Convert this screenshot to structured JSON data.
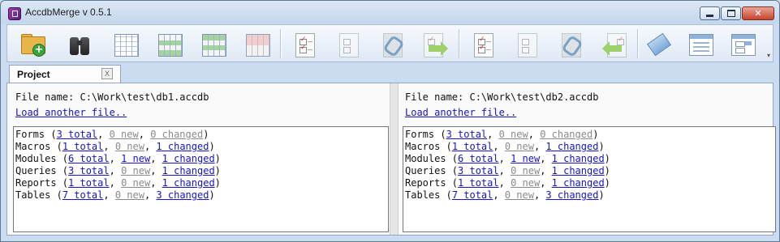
{
  "window": {
    "title": "AccdbMerge v 0.5.1"
  },
  "toolbar": {
    "buttons": [
      {
        "name": "open-folder-button",
        "icon": "folder-add-icon"
      },
      {
        "name": "compare-button",
        "icon": "binoculars-icon"
      },
      {
        "name": "table-view-button",
        "icon": "table-icon"
      },
      {
        "name": "table-green-button",
        "icon": "table-green-icon"
      },
      {
        "name": "table-green2-button",
        "icon": "table-green-alt-icon"
      },
      {
        "name": "table-red-button",
        "icon": "table-red-icon"
      },
      {
        "name": "checklist-button",
        "icon": "checklist-icon"
      },
      {
        "name": "checklist-empty-button",
        "icon": "checklist-empty-icon"
      },
      {
        "name": "link-button",
        "icon": "chain-link-icon"
      },
      {
        "name": "copy-right-button",
        "icon": "arrow-right-icon"
      },
      {
        "name": "checklist2-button",
        "icon": "checklist-icon"
      },
      {
        "name": "checklist2-empty-button",
        "icon": "checklist-empty-icon"
      },
      {
        "name": "link2-button",
        "icon": "chain-link-icon"
      },
      {
        "name": "copy-left-button",
        "icon": "arrow-left-icon"
      },
      {
        "name": "tag-button",
        "icon": "tag-icon"
      },
      {
        "name": "form-button",
        "icon": "form-icon"
      },
      {
        "name": "form2-button",
        "icon": "form-alt-icon"
      }
    ]
  },
  "tabs": [
    {
      "label": "Project",
      "close": "X"
    }
  ],
  "left": {
    "file_name": "File name: C:\\Work\\test\\db1.accdb",
    "load_link": "Load another file..",
    "items": [
      {
        "name": "Forms",
        "total": "3 total",
        "new": "0 new",
        "changed": "0 changed",
        "total_active": true,
        "new_active": false,
        "changed_active": false
      },
      {
        "name": "Macros",
        "total": "1 total",
        "new": "0 new",
        "changed": "1 changed",
        "total_active": true,
        "new_active": false,
        "changed_active": true
      },
      {
        "name": "Modules",
        "total": "6 total",
        "new": "1 new",
        "changed": "1 changed",
        "total_active": true,
        "new_active": true,
        "changed_active": true
      },
      {
        "name": "Queries",
        "total": "3 total",
        "new": "0 new",
        "changed": "1 changed",
        "total_active": true,
        "new_active": false,
        "changed_active": true
      },
      {
        "name": "Reports",
        "total": "1 total",
        "new": "0 new",
        "changed": "1 changed",
        "total_active": true,
        "new_active": false,
        "changed_active": true
      },
      {
        "name": "Tables",
        "total": "7 total",
        "new": "0 new",
        "changed": "3 changed",
        "total_active": true,
        "new_active": false,
        "changed_active": true
      }
    ]
  },
  "right": {
    "file_name": "File name: C:\\Work\\test\\db2.accdb",
    "load_link": "Load another file..",
    "items": [
      {
        "name": "Forms",
        "total": "3 total",
        "new": "0 new",
        "changed": "0 changed",
        "total_active": true,
        "new_active": false,
        "changed_active": false
      },
      {
        "name": "Macros",
        "total": "1 total",
        "new": "0 new",
        "changed": "1 changed",
        "total_active": true,
        "new_active": false,
        "changed_active": true
      },
      {
        "name": "Modules",
        "total": "6 total",
        "new": "1 new",
        "changed": "1 changed",
        "total_active": true,
        "new_active": true,
        "changed_active": true
      },
      {
        "name": "Queries",
        "total": "3 total",
        "new": "0 new",
        "changed": "1 changed",
        "total_active": true,
        "new_active": false,
        "changed_active": true
      },
      {
        "name": "Reports",
        "total": "1 total",
        "new": "0 new",
        "changed": "1 changed",
        "total_active": true,
        "new_active": false,
        "changed_active": true
      },
      {
        "name": "Tables",
        "total": "7 total",
        "new": "0 new",
        "changed": "3 changed",
        "total_active": true,
        "new_active": false,
        "changed_active": true
      }
    ]
  }
}
